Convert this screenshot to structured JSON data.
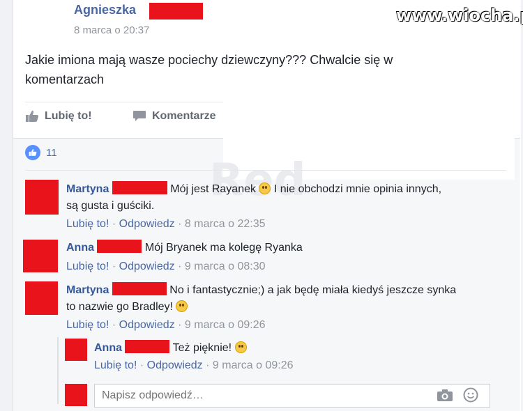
{
  "watermark": "www.wiocha.pl",
  "post": {
    "author": "Agnieszka",
    "timestamp": "8 marca o 20:37",
    "text": "Jakie imiona mają wasze pociechy dziewczyny??? Chwalcie się w komentarzach",
    "like_label": "Lubię to!",
    "comment_label": "Komentarze",
    "likes_count": "11"
  },
  "comments": [
    {
      "name": "Martyna",
      "text_part1": "Mój jest Rayanek",
      "text_part2": "I nie obchodzi mnie opinia innych,",
      "text_line2": "są gusta i guściki.",
      "like": "Lubię to!",
      "sep": "·",
      "reply": "Odpowiedz",
      "time": "8 marca o 22:35"
    },
    {
      "name": "Anna",
      "text": "Mój Bryanek ma kolegę Ryanka",
      "like": "Lubię to!",
      "sep": "·",
      "reply": "Odpowiedz",
      "time": "9 marca o 08:30"
    },
    {
      "name": "Martyna",
      "text": "No i fantastycznie;) a jak będę miała kiedyś jeszcze synka",
      "text_line2": "to nazwie go Bradley!",
      "like": "Lubię to!",
      "sep": "·",
      "reply": "Odpowiedz",
      "time": "9 marca o 09:26"
    },
    {
      "name": "Anna",
      "text": "Też pięknie!",
      "like": "Lubię to!",
      "sep": "·",
      "reply": "Odpowiedz",
      "time": "9 marca o 09:26"
    }
  ],
  "reply_box": {
    "placeholder": "Napisz odpowiedź…"
  },
  "colors": {
    "redaction": "#e8131b",
    "link": "#4b67a1",
    "meta": "#90949c"
  }
}
